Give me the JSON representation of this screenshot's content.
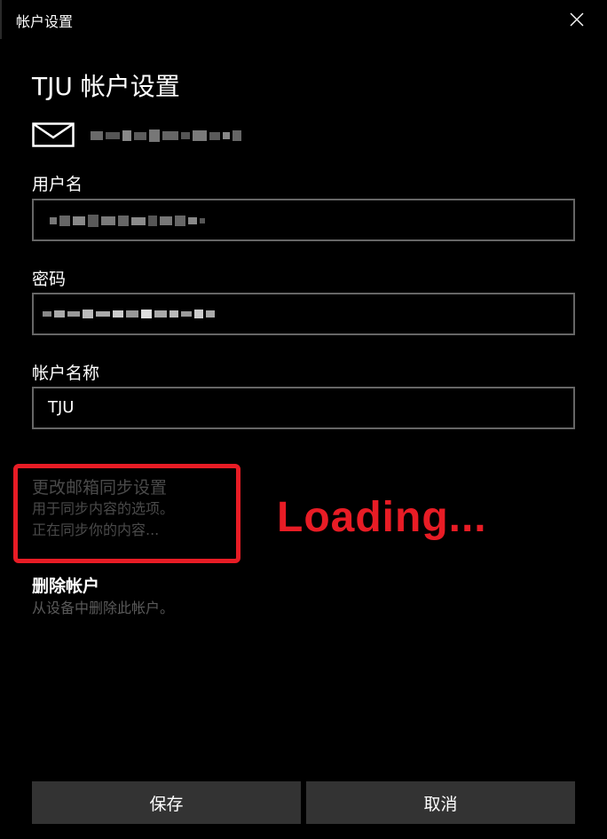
{
  "window": {
    "title": "帐户设置",
    "close_icon": "close-icon"
  },
  "heading": "TJU 帐户设置",
  "email": {
    "icon": "mail-icon",
    "value_redacted": true
  },
  "fields": {
    "username": {
      "label": "用户名",
      "value_redacted": true
    },
    "password": {
      "label": "密码",
      "value_redacted": true
    },
    "account_name": {
      "label": "帐户名称",
      "value": "TJU"
    }
  },
  "sync": {
    "title": "更改邮箱同步设置",
    "description": "用于同步内容的选项。",
    "status": "正在同步你的内容..."
  },
  "annotation": {
    "text": "Loading...",
    "color": "#e81c25"
  },
  "delete": {
    "title": "删除帐户",
    "description": "从设备中删除此帐户。"
  },
  "buttons": {
    "save": "保存",
    "cancel": "取消"
  },
  "colors": {
    "background": "#000000",
    "button": "#333333",
    "textbox_border": "#666666",
    "disabled_text": "#4a4a4a"
  }
}
